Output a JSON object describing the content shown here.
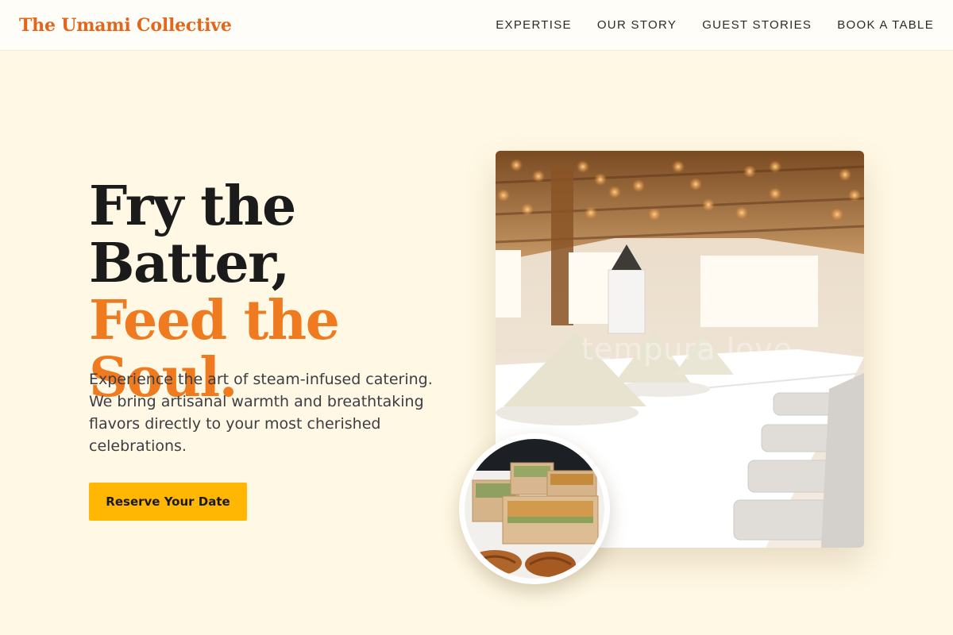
{
  "header": {
    "brand": "The Umami Collective",
    "nav": [
      "EXPERTISE",
      "OUR STORY",
      "GUEST STORIES",
      "BOOK A TABLE"
    ]
  },
  "hero": {
    "headline_line1": "Fry the",
    "headline_line2": "Batter,",
    "headline_accent": "Feed the Soul.",
    "description": "Experience the art of steam-infused catering. We bring artisanal warmth and breathtaking flavors directly to your most cherished celebrations.",
    "cta_label": "Reserve Your Date"
  },
  "media": {
    "main_image_watermark": "tempura love",
    "inset_image": "catering-boxes-photo"
  },
  "colors": {
    "brand": "#e2661b",
    "accent": "#ef7a1f",
    "cta": "#ffb703",
    "background": "#fff8e4"
  }
}
